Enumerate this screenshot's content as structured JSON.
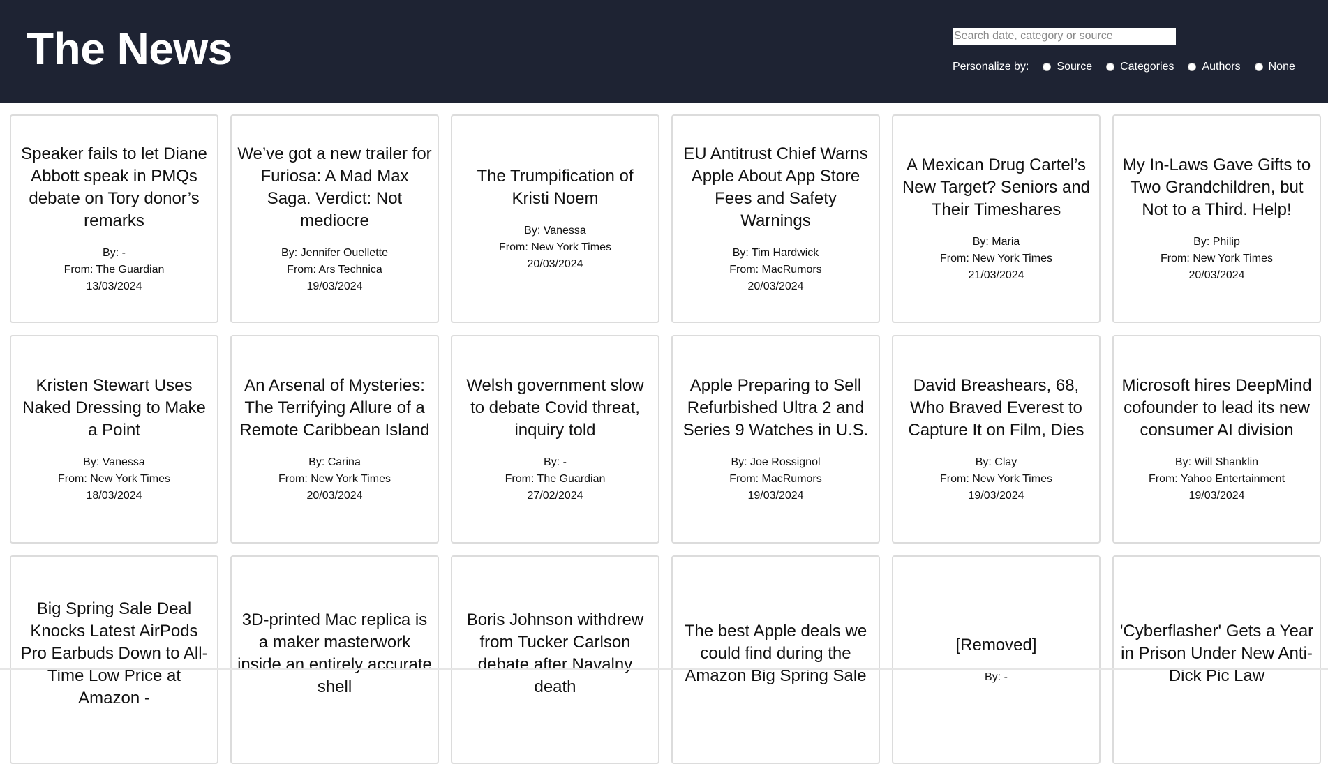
{
  "header": {
    "title": "The News",
    "search_placeholder": "Search date, category or source",
    "personalize_label": "Personalize by:",
    "options": [
      "Source",
      "Categories",
      "Authors",
      "None"
    ]
  },
  "colors": {
    "header_background": "#1e2333",
    "card_border": "#dcdcdc"
  },
  "articles": [
    {
      "title": "Speaker fails to let Diane Abbott speak in PMQs debate on Tory donor’s remarks",
      "by": "By: -",
      "from": "From: The Guardian",
      "date": "13/03/2024"
    },
    {
      "title": "We’ve got a new trailer for Furiosa: A Mad Max Saga. Verdict: Not mediocre",
      "by": "By: Jennifer Ouellette",
      "from": "From: Ars Technica",
      "date": "19/03/2024"
    },
    {
      "title": "The Trumpification of Kristi Noem",
      "by": "By: Vanessa",
      "from": "From: New York Times",
      "date": "20/03/2024"
    },
    {
      "title": "EU Antitrust Chief Warns Apple About App Store Fees and Safety Warnings",
      "by": "By: Tim Hardwick",
      "from": "From: MacRumors",
      "date": "20/03/2024"
    },
    {
      "title": "A Mexican Drug Cartel’s New Target? Seniors and Their Timeshares",
      "by": "By: Maria",
      "from": "From: New York Times",
      "date": "21/03/2024"
    },
    {
      "title": "My In-Laws Gave Gifts to Two Grandchildren, but Not to a Third. Help!",
      "by": "By: Philip",
      "from": "From: New York Times",
      "date": "20/03/2024"
    },
    {
      "title": "Kristen Stewart Uses Naked Dressing to Make a Point",
      "by": "By: Vanessa",
      "from": "From: New York Times",
      "date": "18/03/2024"
    },
    {
      "title": "An Arsenal of Mysteries: The Terrifying Allure of a Remote Caribbean Island",
      "by": "By: Carina",
      "from": "From: New York Times",
      "date": "20/03/2024"
    },
    {
      "title": "Welsh government slow to debate Covid threat, inquiry told",
      "by": "By: -",
      "from": "From: The Guardian",
      "date": "27/02/2024"
    },
    {
      "title": "Apple Preparing to Sell Refurbished Ultra 2 and Series 9 Watches in U.S.",
      "by": "By: Joe Rossignol",
      "from": "From: MacRumors",
      "date": "19/03/2024"
    },
    {
      "title": "David Breashears, 68, Who Braved Everest to Capture It on Film, Dies",
      "by": "By: Clay",
      "from": "From: New York Times",
      "date": "19/03/2024"
    },
    {
      "title": "Microsoft hires DeepMind cofounder to lead its new consumer AI division",
      "by": "By: Will Shanklin",
      "from": "From: Yahoo Entertainment",
      "date": "19/03/2024"
    },
    {
      "title": "Big Spring Sale Deal Knocks Latest AirPods Pro Earbuds Down to All-Time Low Price at Amazon -",
      "by": "",
      "from": "",
      "date": ""
    },
    {
      "title": "3D-printed Mac replica is a maker masterwork inside an entirely accurate shell",
      "by": "",
      "from": "",
      "date": ""
    },
    {
      "title": "Boris Johnson withdrew from Tucker Carlson debate after Navalny death",
      "by": "",
      "from": "",
      "date": ""
    },
    {
      "title": "The best Apple deals we could find during the Amazon Big Spring Sale",
      "by": "",
      "from": "",
      "date": ""
    },
    {
      "title": "[Removed]",
      "by": "By: -",
      "from": "",
      "date": ""
    },
    {
      "title": "'Cyberflasher' Gets a Year in Prison Under New Anti-Dick Pic Law",
      "by": "",
      "from": "",
      "date": ""
    }
  ]
}
